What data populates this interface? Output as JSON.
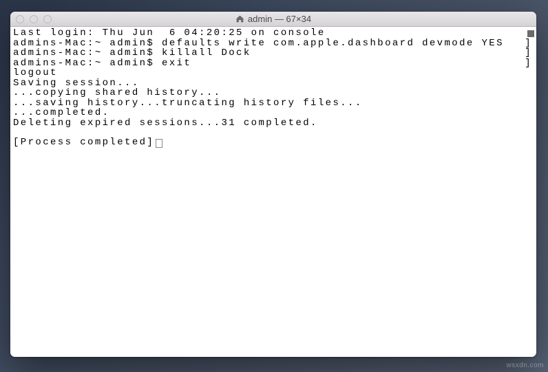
{
  "window": {
    "title": "admin — 67×34"
  },
  "terminal": {
    "lines": [
      "Last login: Thu Jun  6 04:20:25 on console",
      "admins-Mac:~ admin$ defaults write com.apple.dashboard devmode YES",
      "admins-Mac:~ admin$ killall Dock",
      "admins-Mac:~ admin$ exit",
      "logout",
      "Saving session...",
      "...copying shared history...",
      "...saving history...truncating history files...",
      "...completed.",
      "Deleting expired sessions...31 completed."
    ],
    "final_line": "[Process completed]",
    "cont_marker": "]"
  },
  "watermark": "wsxdn.com"
}
